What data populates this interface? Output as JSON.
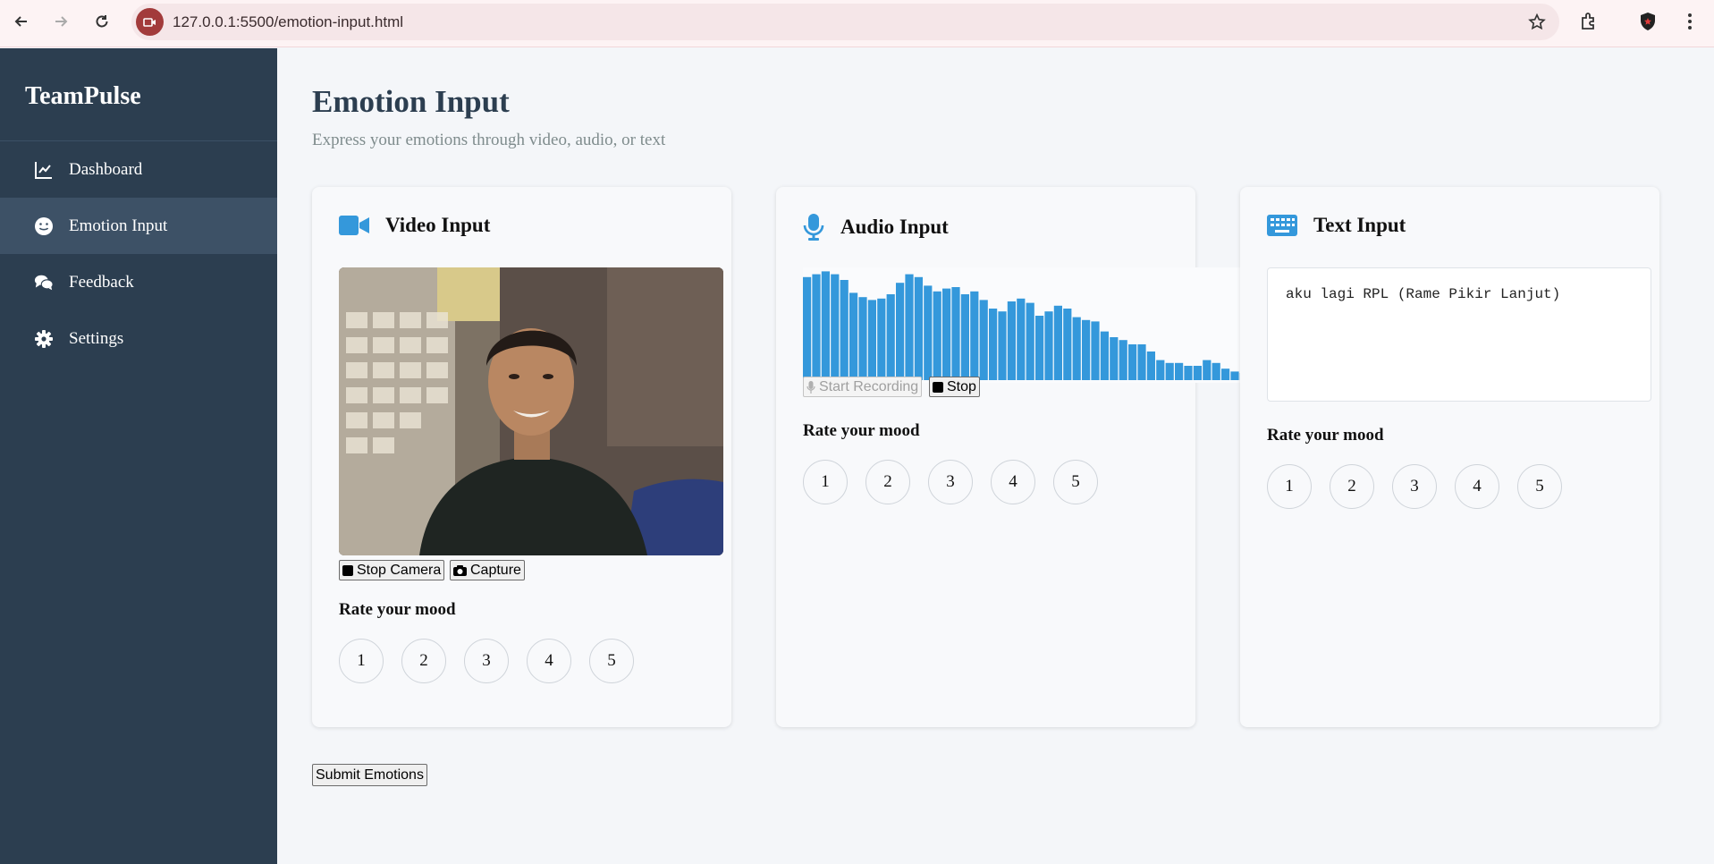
{
  "browser": {
    "url": "127.0.0.1:5500/emotion-input.html"
  },
  "sidebar": {
    "brand": "TeamPulse",
    "items": [
      {
        "label": "Dashboard",
        "icon": "chart-line-icon"
      },
      {
        "label": "Emotion Input",
        "icon": "smile-icon",
        "active": true
      },
      {
        "label": "Feedback",
        "icon": "comments-icon"
      },
      {
        "label": "Settings",
        "icon": "gear-icon"
      }
    ]
  },
  "page": {
    "title": "Emotion Input",
    "subtitle": "Express your emotions through video, audio, or text"
  },
  "video": {
    "title": "Video Input",
    "stop_label": "Stop Camera",
    "capture_label": "Capture",
    "rate_label": "Rate your mood"
  },
  "audio": {
    "title": "Audio Input",
    "start_label": "Start Recording",
    "stop_label": "Stop",
    "rate_label": "Rate your mood"
  },
  "text": {
    "title": "Text Input",
    "value": "aku lagi RPL (Rame Pikir Lanjut)",
    "rate_label": "Rate your mood"
  },
  "rating_options": [
    "1",
    "2",
    "3",
    "4",
    "5"
  ],
  "submit_label": "Submit Emotions",
  "colors": {
    "sidebar": "#2c3e50",
    "accent": "#3498db",
    "background": "#f4f6f9"
  }
}
